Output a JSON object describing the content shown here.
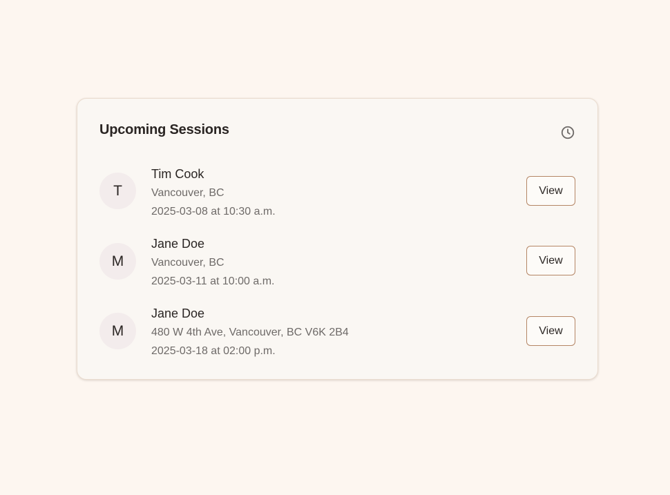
{
  "card": {
    "title": "Upcoming Sessions",
    "header_icon": "clock-icon"
  },
  "sessions": [
    {
      "initial": "T",
      "name": "Tim Cook",
      "location": "Vancouver, BC",
      "datetime": "2025-03-08 at 10:30 a.m.",
      "action_label": "View"
    },
    {
      "initial": "M",
      "name": "Jane Doe",
      "location": "Vancouver, BC",
      "datetime": "2025-03-11 at 10:00 a.m.",
      "action_label": "View"
    },
    {
      "initial": "M",
      "name": "Jane Doe",
      "location": "480 W 4th Ave, Vancouver, BC V6K 2B4",
      "datetime": "2025-03-18 at 02:00 p.m.",
      "action_label": "View"
    }
  ],
  "colors": {
    "page_background": "#fdf6f0",
    "card_background": "#faf7f3",
    "avatar_background": "#f3ecec",
    "button_border": "#b48564",
    "primary_text": "#2a2523",
    "secondary_text": "#6e6a68"
  }
}
